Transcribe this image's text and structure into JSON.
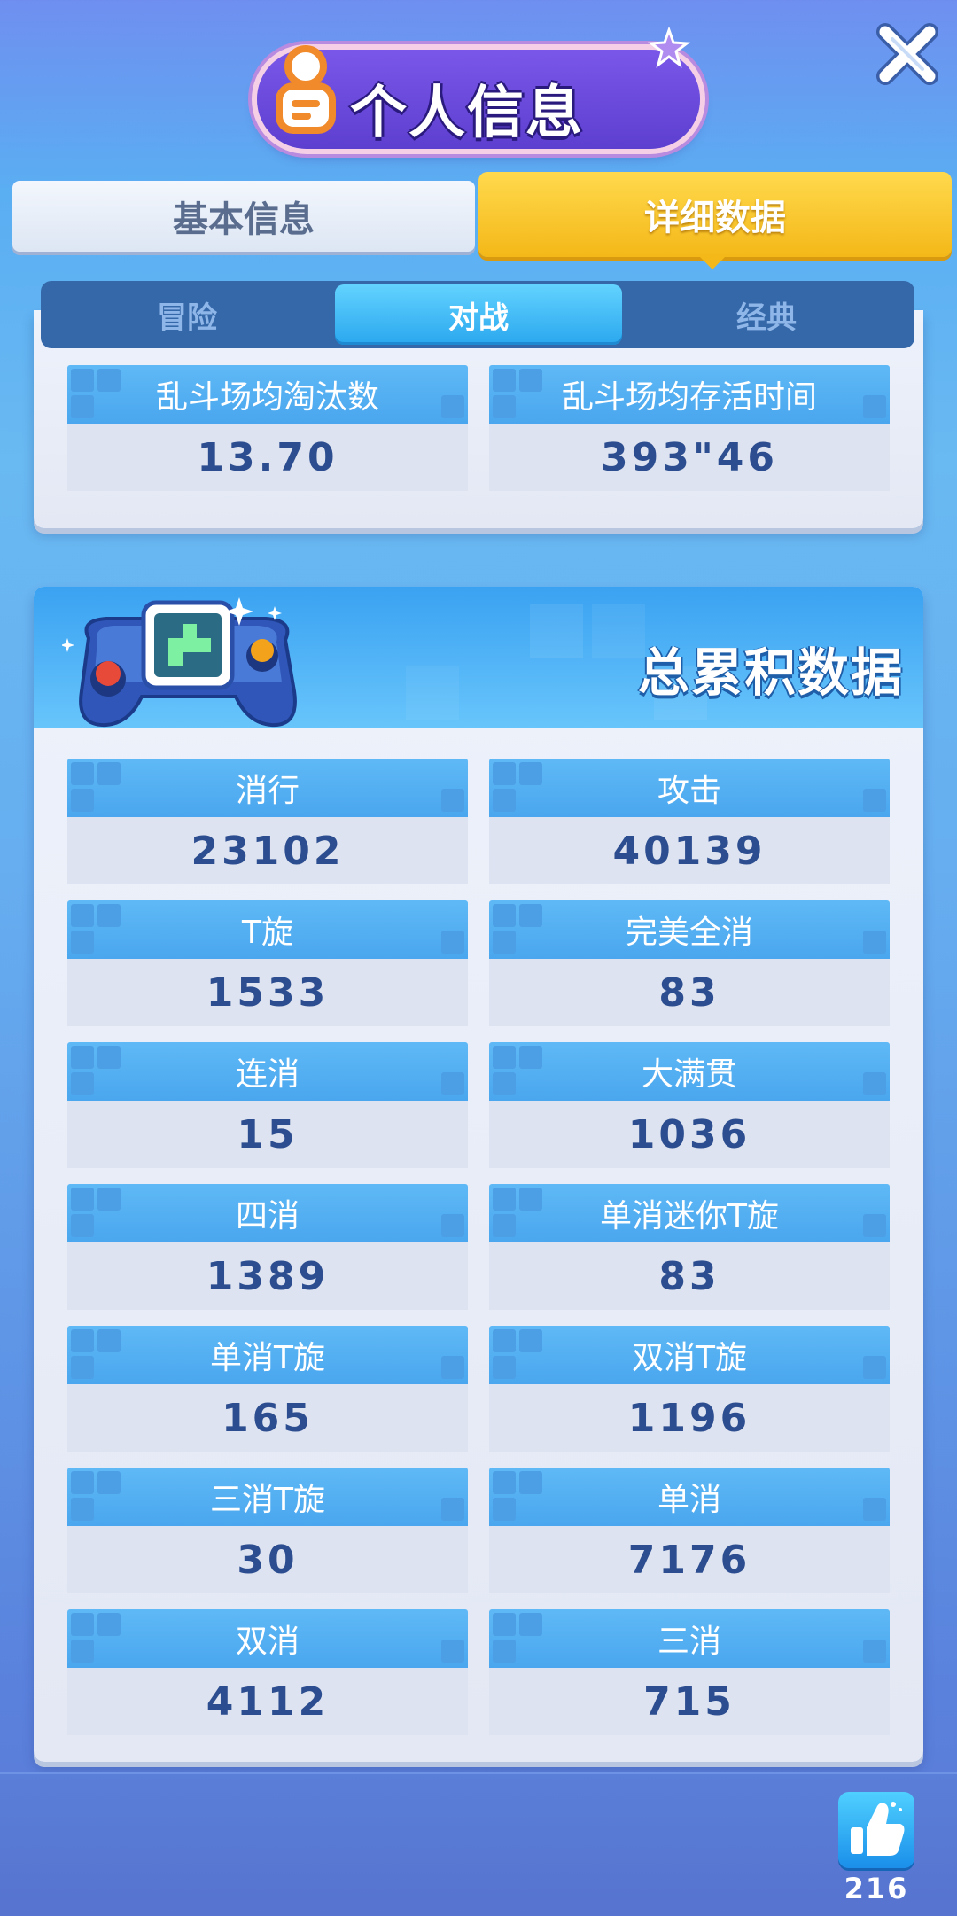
{
  "header": {
    "title": "个人信息",
    "close_icon": "close-icon",
    "profile_icon": "profile-icon"
  },
  "tabs": {
    "basic": "基本信息",
    "detail": "详细数据",
    "active": "detail"
  },
  "subtabs": {
    "adventure": "冒险",
    "battle": "对战",
    "classic": "经典",
    "active": "battle"
  },
  "top_stats": [
    {
      "label": "乱斗场均淘汰数",
      "value": "13.70"
    },
    {
      "label": "乱斗场均存活时间",
      "value": "393\"46"
    }
  ],
  "cumulative": {
    "title": "总累积数据",
    "stats": [
      {
        "label": "消行",
        "value": "23102"
      },
      {
        "label": "攻击",
        "value": "40139"
      },
      {
        "label": "T旋",
        "value": "1533"
      },
      {
        "label": "完美全消",
        "value": "83"
      },
      {
        "label": "连消",
        "value": "15"
      },
      {
        "label": "大满贯",
        "value": "1036"
      },
      {
        "label": "四消",
        "value": "1389"
      },
      {
        "label": "单消迷你T旋",
        "value": "83"
      },
      {
        "label": "单消T旋",
        "value": "165"
      },
      {
        "label": "双消T旋",
        "value": "1196"
      },
      {
        "label": "三消T旋",
        "value": "30"
      },
      {
        "label": "单消",
        "value": "7176"
      },
      {
        "label": "双消",
        "value": "4112"
      },
      {
        "label": "三消",
        "value": "715"
      }
    ]
  },
  "like": {
    "icon": "thumbs-up-icon",
    "count": "216"
  },
  "colors": {
    "tab_active": "#f4b818",
    "subtab_active": "#2aa7ee",
    "stat_label_bg": "#4aa6ee",
    "stat_value_text": "#2c4d8f"
  }
}
